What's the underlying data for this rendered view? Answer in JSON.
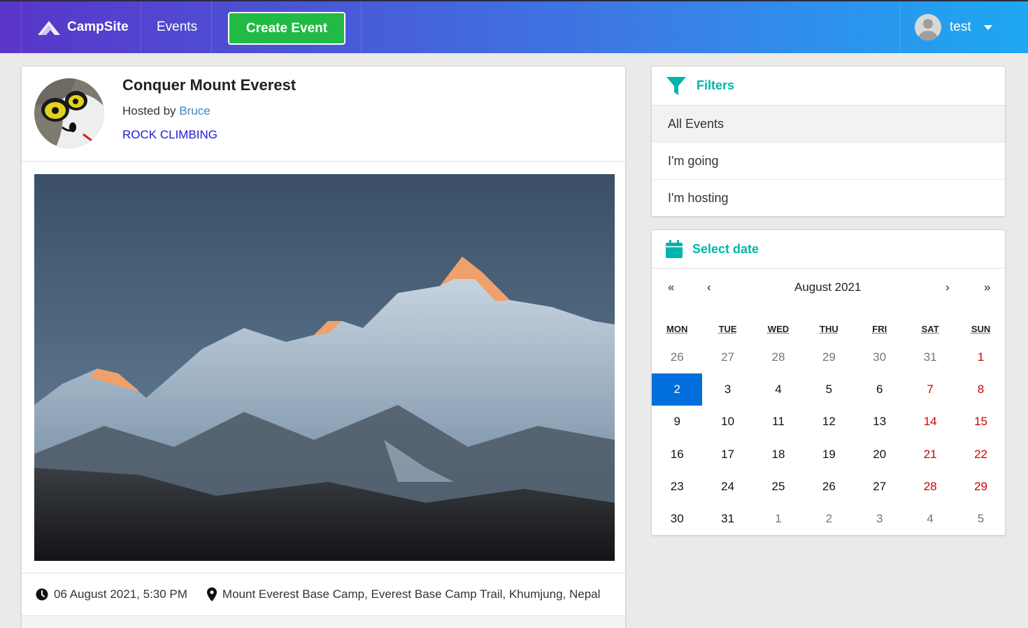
{
  "navbar": {
    "brand": "CampSite",
    "events": "Events",
    "create_event": "Create Event",
    "user": "test"
  },
  "event": {
    "title": "Conquer Mount Everest",
    "hosted_prefix": "Hosted by ",
    "host": "Bruce",
    "category": "ROCK CLIMBING",
    "datetime": "06 August 2021, 5:30 PM",
    "location": "Mount Everest Base Camp, Everest Base Camp Trail, Khumjung, Nepal"
  },
  "filters": {
    "header": "Filters",
    "items": [
      "All Events",
      "I'm going",
      "I'm hosting"
    ],
    "active_index": 0
  },
  "calendar": {
    "header": "Select date",
    "month": "August 2021",
    "nav": {
      "prev2": "«",
      "prev": "‹",
      "next": "›",
      "next2": "»"
    },
    "weekdays": [
      "MON",
      "TUE",
      "WED",
      "THU",
      "FRI",
      "SAT",
      "SUN"
    ],
    "weeks": [
      [
        "26",
        "27",
        "28",
        "29",
        "30",
        "31",
        "1"
      ],
      [
        "2",
        "3",
        "4",
        "5",
        "6",
        "7",
        "8"
      ],
      [
        "9",
        "10",
        "11",
        "12",
        "13",
        "14",
        "15"
      ],
      [
        "16",
        "17",
        "18",
        "19",
        "20",
        "21",
        "22"
      ],
      [
        "23",
        "24",
        "25",
        "26",
        "27",
        "28",
        "29"
      ],
      [
        "30",
        "31",
        "1",
        "2",
        "3",
        "4",
        "5"
      ]
    ],
    "selected": "2",
    "accent": "#006edc",
    "weekend_color": "#d10000"
  },
  "colors": {
    "create_button": "#21ba45",
    "header_teal": "#00b5ad"
  }
}
